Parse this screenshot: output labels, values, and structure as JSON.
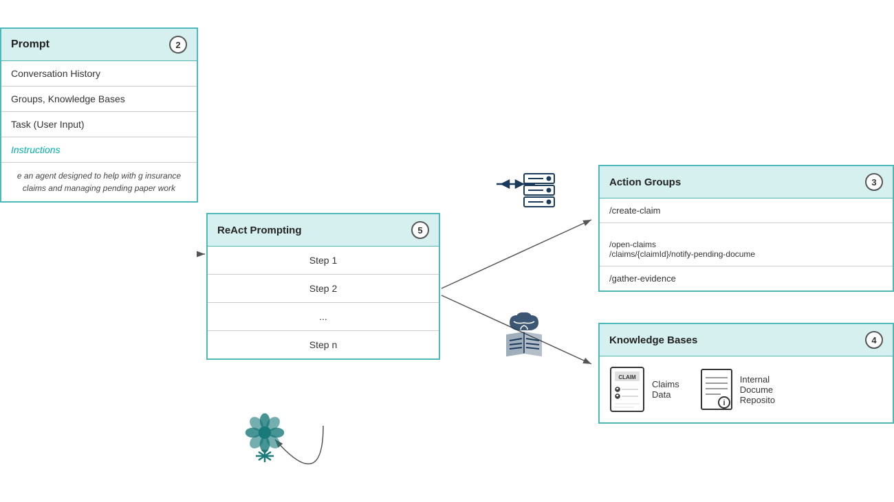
{
  "prompt": {
    "title": "Prompt",
    "badge": "2",
    "rows": [
      {
        "label": "Conversation History"
      },
      {
        "label": "Groups, Knowledge Bases"
      },
      {
        "label": "Task (User Input)"
      },
      {
        "label": "Instructions",
        "style": "instructions"
      }
    ],
    "description": "e an agent designed to help with\ng insurance claims and managing\npending paper work"
  },
  "react": {
    "title": "ReAct Prompting",
    "badge": "5",
    "steps": [
      "Step 1",
      "Step 2",
      "...",
      "Step n"
    ]
  },
  "actionGroups": {
    "title": "Action Groups",
    "badge": "3",
    "rows": [
      "/create-claim",
      "/open-claims\n/claims/{claimId}/notify-pending-docume",
      "/gather-evidence"
    ]
  },
  "knowledgeBases": {
    "title": "Knowledge Bases",
    "badge": "4",
    "items": [
      {
        "icon": "claims-doc-icon",
        "label": "Claims\nData"
      },
      {
        "icon": "internal-doc-icon",
        "label": "Internal\nDocume\nReposito"
      }
    ]
  }
}
